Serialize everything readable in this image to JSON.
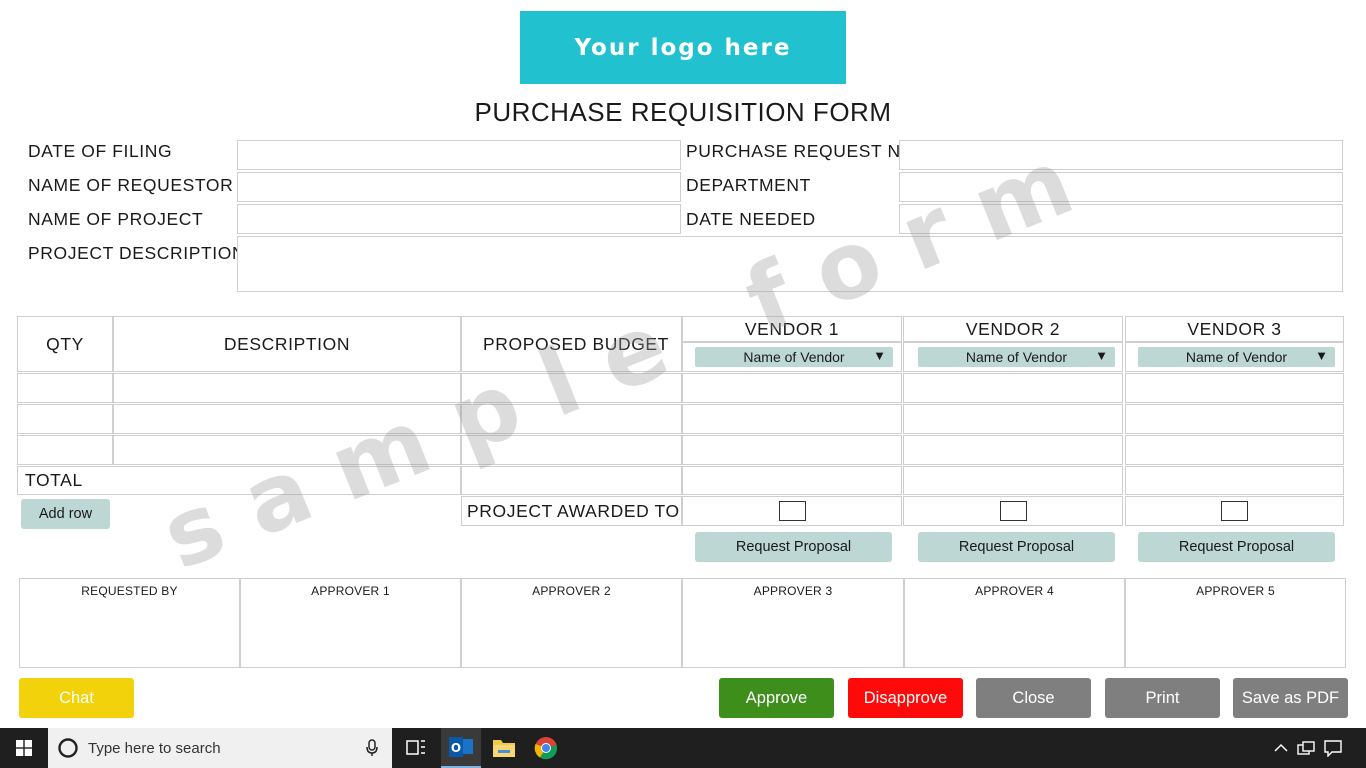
{
  "logo": {
    "text": "Your logo here",
    "bg": "#21c1cf"
  },
  "form": {
    "title": "PURCHASE REQUISITION FORM",
    "labels": {
      "date_of_filing": "DATE OF FILING",
      "purchase_request_no": "PURCHASE REQUEST NO",
      "name_of_requestor": "NAME OF REQUESTOR",
      "department": "DEPARTMENT",
      "name_of_project": "NAME OF PROJECT",
      "date_needed": "DATE NEEDED",
      "project_description": "PROJECT DESCRIPTION"
    },
    "values": {
      "date_of_filing": "",
      "purchase_request_no": "",
      "name_of_requestor": "",
      "department": "",
      "name_of_project": "",
      "date_needed": "",
      "project_description": ""
    }
  },
  "items_table": {
    "headers": {
      "qty": "QTY",
      "description": "DESCRIPTION",
      "budget": "PROPOSED BUDGET"
    },
    "vendors": [
      {
        "label": "VENDOR 1",
        "selected": "Name of Vendor"
      },
      {
        "label": "VENDOR 2",
        "selected": "Name of Vendor"
      },
      {
        "label": "VENDOR 3",
        "selected": "Name of Vendor"
      }
    ],
    "rows": [
      {
        "qty": "",
        "description": "",
        "budget": "",
        "v1": "",
        "v2": "",
        "v3": ""
      },
      {
        "qty": "",
        "description": "",
        "budget": "",
        "v1": "",
        "v2": "",
        "v3": ""
      },
      {
        "qty": "",
        "description": "",
        "budget": "",
        "v1": "",
        "v2": "",
        "v3": ""
      }
    ],
    "total_label": "TOTAL",
    "add_row_label": "Add row",
    "project_awarded_label": "PROJECT AWARDED TO",
    "request_proposal_label": "Request Proposal"
  },
  "signatures": [
    "REQUESTED BY",
    "APPROVER 1",
    "APPROVER 2",
    "APPROVER 3",
    "APPROVER 4",
    "APPROVER 5"
  ],
  "watermark": "s a m p l e   f o r m",
  "actions": {
    "chat": {
      "label": "Chat",
      "color": "#f2d20a"
    },
    "approve": {
      "label": "Approve",
      "color": "#3e8e1b"
    },
    "disapprove": {
      "label": "Disapprove",
      "color": "#ff0a0a"
    },
    "close": {
      "label": "Close",
      "color": "#7f7f7f"
    },
    "print": {
      "label": "Print",
      "color": "#7f7f7f"
    },
    "save_pdf": {
      "label": "Save as PDF",
      "color": "#7f7f7f"
    }
  },
  "taskbar": {
    "search_placeholder": "Type here to search",
    "icons": [
      "windows-start-icon",
      "cortana-icon",
      "microphone-icon",
      "task-view-icon",
      "outlook-icon",
      "file-explorer-icon",
      "chrome-icon",
      "chevron-up-icon",
      "network-icon",
      "notification-icon"
    ]
  }
}
